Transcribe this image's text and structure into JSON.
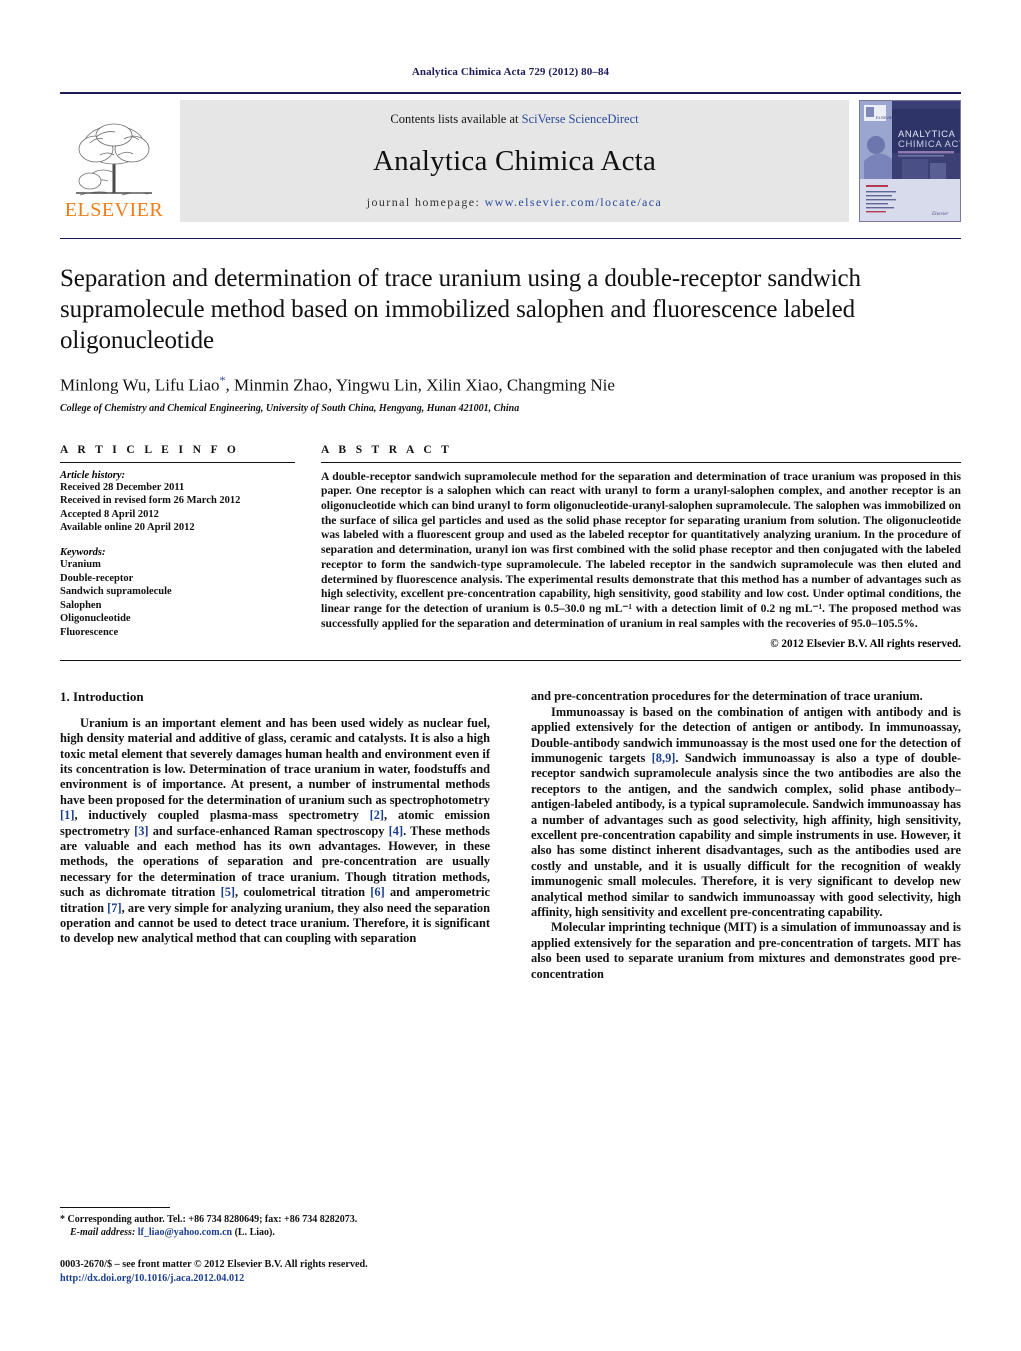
{
  "running_head": "Analytica Chimica Acta 729 (2012) 80–84",
  "masthead": {
    "publisher_name": "ELSEVIER",
    "contents_prefix": "Contents lists available at ",
    "contents_link": "SciVerse ScienceDirect",
    "journal_title": "Analytica Chimica Acta",
    "homepage_prefix": "journal homepage: ",
    "homepage_url": "www.elsevier.com/locate/aca",
    "cover_title_line1": "ANALYTICA",
    "cover_title_line2": "CHIMICA ACTA"
  },
  "article": {
    "title": "Separation and determination of trace uranium using a double-receptor sandwich supramolecule method based on immobilized salophen and fluorescence labeled oligonucleotide",
    "authors": "Minlong Wu, Lifu Liao",
    "authors_rest": ", Minmin Zhao, Yingwu Lin, Xilin Xiao, Changming Nie",
    "corresponding_marker": "*",
    "affiliation": "College of Chemistry and Chemical Engineering, University of South China, Hengyang, Hunan 421001, China"
  },
  "article_info": {
    "heading": "A R T I C L E  I N F O",
    "history_label": "Article history:",
    "history": [
      "Received 28 December 2011",
      "Received in revised form 26 March 2012",
      "Accepted 8 April 2012",
      "Available online 20 April 2012"
    ],
    "keywords_label": "Keywords:",
    "keywords": [
      "Uranium",
      "Double-receptor",
      "Sandwich supramolecule",
      "Salophen",
      "Oligonucleotide",
      "Fluorescence"
    ]
  },
  "abstract": {
    "heading": "A B S T R A C T",
    "text": "A double-receptor sandwich supramolecule method for the separation and determination of trace uranium was proposed in this paper. One receptor is a salophen which can react with uranyl to form a uranyl-salophen complex, and another receptor is an oligonucleotide which can bind uranyl to form oligonucleotide-uranyl-salophen supramolecule. The salophen was immobilized on the surface of silica gel particles and used as the solid phase receptor for separating uranium from solution. The oligonucleotide was labeled with a fluorescent group and used as the labeled receptor for quantitatively analyzing uranium. In the procedure of separation and determination, uranyl ion was first combined with the solid phase receptor and then conjugated with the labeled receptor to form the sandwich-type supramolecule. The labeled receptor in the sandwich supramolecule was then eluted and determined by fluorescence analysis. The experimental results demonstrate that this method has a number of advantages such as high selectivity, excellent pre-concentration capability, high sensitivity, good stability and low cost. Under optimal conditions, the linear range for the detection of uranium is 0.5–30.0 ng mL⁻¹ with a detection limit of 0.2 ng mL⁻¹. The proposed method was successfully applied for the separation and determination of uranium in real samples with the recoveries of 95.0–105.5%.",
    "copyright": "© 2012 Elsevier B.V. All rights reserved."
  },
  "body": {
    "section_heading": "1. Introduction",
    "left_paragraphs": [
      "Uranium is an important element and has been used widely as nuclear fuel, high density material and additive of glass, ceramic and catalysts. It is also a high toxic metal element that severely damages human health and environment even if its concentration is low. Determination of trace uranium in water, foodstuffs and environment is of importance. At present, a number of instrumental methods have been proposed for the determination of uranium such as spectrophotometry [1], inductively coupled plasma-mass spectrometry [2], atomic emission spectrometry [3] and surface-enhanced Raman spectroscopy [4]. These methods are valuable and each method has its own advantages. However, in these methods, the operations of separation and pre-concentration are usually necessary for the determination of trace uranium. Though titration methods, such as dichromate titration [5], coulometrical titration [6] and amperometric titration [7], are very simple for analyzing uranium, they also need the separation operation and cannot be used to detect trace uranium. Therefore, it is significant to develop new analytical method that can coupling with separation"
    ],
    "right_paragraphs": [
      "and pre-concentration procedures for the determination of trace uranium.",
      "Immunoassay is based on the combination of antigen with antibody and is applied extensively for the detection of antigen or antibody. In immunoassay, Double-antibody sandwich immunoassay is the most used one for the detection of immunogenic targets [8,9]. Sandwich immunoassay is also a type of double-receptor sandwich supramolecule analysis since the two antibodies are also the receptors to the antigen, and the sandwich complex, solid phase antibody–antigen-labeled antibody, is a typical supramolecule. Sandwich immunoassay has a number of advantages such as good selectivity, high affinity, high sensitivity, excellent pre-concentration capability and simple instruments in use. However, it also has some distinct inherent disadvantages, such as the antibodies used are costly and unstable, and it is usually difficult for the recognition of weakly immunogenic small molecules. Therefore, it is very significant to develop new analytical method similar to sandwich immunoassay with good selectivity, high affinity, high sensitivity and excellent pre-concentrating capability.",
      "Molecular imprinting technique (MIT) is a simulation of immunoassay and is applied extensively for the separation and pre-concentration of targets. MIT has also been used to separate uranium from mixtures and demonstrates good pre-concentration"
    ]
  },
  "footer": {
    "corresponding_marker": "*",
    "corresponding_text": "Corresponding author. Tel.: +86 734 8280649; fax: +86 734 8282073.",
    "email_label": "E-mail address:",
    "email": "lf_liao@yahoo.com.cn",
    "email_owner": "(L. Liao).",
    "imprint_line": "0003-2670/$ – see front matter © 2012 Elsevier B.V. All rights reserved.",
    "doi": "http://dx.doi.org/10.1016/j.aca.2012.04.012"
  },
  "colors": {
    "header_navy": "#1b1b5c",
    "link_blue": "#1b3f8f",
    "elsevier_orange": "#f07c18",
    "band_gray": "#e6e6e6"
  }
}
